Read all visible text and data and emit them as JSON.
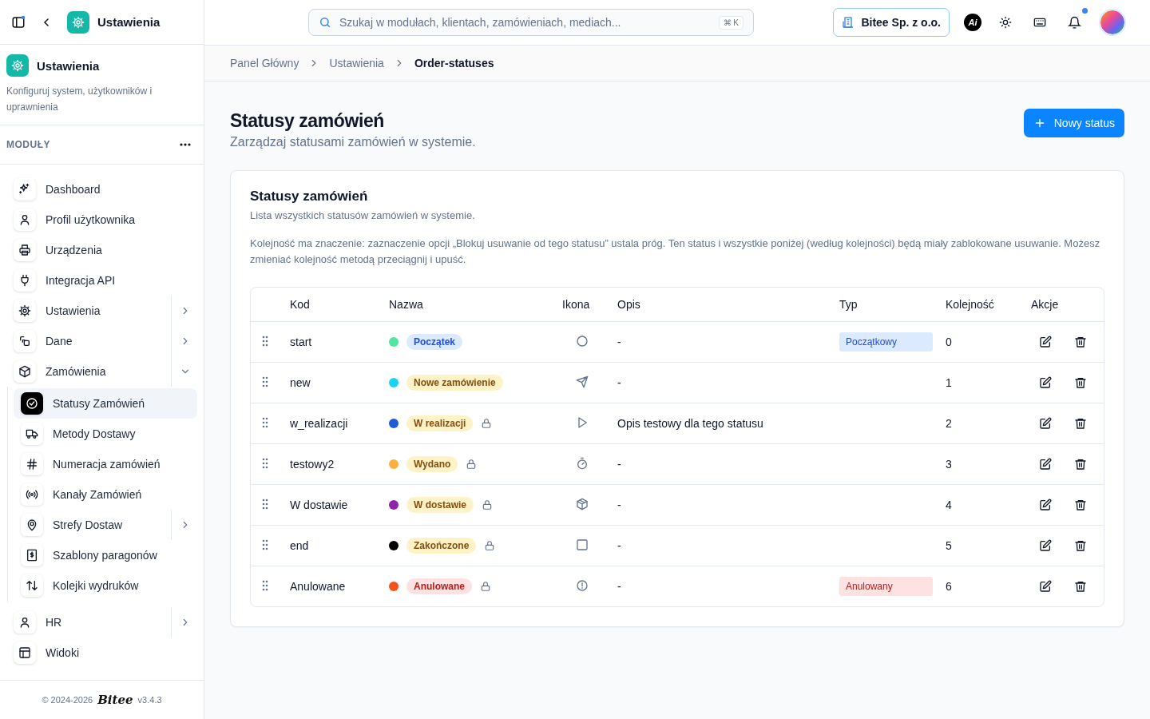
{
  "app_header": {
    "title": "Ustawienia"
  },
  "sidebar": {
    "title": "Ustawienia",
    "description": "Konfiguruj system, użytkowników i uprawnienia",
    "section": "MODUŁY",
    "items": [
      {
        "label": "Dashboard",
        "kind": "sparkles",
        "selected": false
      },
      {
        "label": "Profil użytkownika",
        "kind": "user",
        "selected": false
      },
      {
        "label": "Urządzenia",
        "kind": "printer",
        "selected": false
      },
      {
        "label": "Integracja API",
        "kind": "plug",
        "selected": false
      },
      {
        "label": "Ustawienia",
        "kind": "cog",
        "selected": false,
        "expandable": true,
        "expanded": false
      },
      {
        "label": "Dane",
        "kind": "shapes",
        "selected": false,
        "expandable": true,
        "expanded": false
      },
      {
        "label": "Zamówienia",
        "kind": "box",
        "selected": false,
        "expandable": true,
        "expanded": true,
        "children": [
          {
            "label": "Statusy Zamówień",
            "kind": "check",
            "selected": true
          },
          {
            "label": "Metody Dostawy",
            "kind": "truck",
            "selected": false
          },
          {
            "label": "Numeracja zamówień",
            "kind": "hash",
            "selected": false
          },
          {
            "label": "Kanały Zamówień",
            "kind": "radio",
            "selected": false
          },
          {
            "label": "Strefy Dostaw",
            "kind": "pin",
            "selected": false,
            "expandable": true,
            "expanded": false
          },
          {
            "label": "Szablony paragonów",
            "kind": "receipt",
            "selected": false
          },
          {
            "label": "Kolejki wydruków",
            "kind": "arrows",
            "selected": false
          }
        ]
      },
      {
        "label": "HR",
        "kind": "user",
        "selected": false,
        "expandable": true,
        "expanded": false
      },
      {
        "label": "Widoki",
        "kind": "layout",
        "selected": false
      }
    ],
    "footer": {
      "copyright": "© 2024-2026",
      "brand": "Bitee",
      "version": "v3.4.3"
    }
  },
  "topbar": {
    "search": {
      "placeholder": "Szukaj w modułach, klientach, zamówieniach, mediach...",
      "shortcut": "⌘ K"
    },
    "company": "Bitee Sp. z o.o.",
    "ai_label": "Ai",
    "notifications_unread": true
  },
  "breadcrumbs": [
    {
      "label": "Panel Główny",
      "current": false
    },
    {
      "label": "Ustawienia",
      "current": false
    },
    {
      "label": "Order-statuses",
      "current": true
    }
  ],
  "page": {
    "title": "Statusy zamówień",
    "subtitle": "Zarządzaj statusami zamówień w systemie.",
    "primary_button": "Nowy status"
  },
  "card": {
    "title": "Statusy zamówień",
    "subtitle": "Lista wszystkich statusów zamówień w systemie.",
    "note": "Kolejność ma znaczenie: zaznaczenie opcji „Blokuj usuwanie od tego statusu” ustala próg. Ten status i wszystkie poniżej (według kolejności) będą miały zablokowane usuwanie. Możesz zmieniać kolejność metodą przeciągnij i upuść."
  },
  "table": {
    "columns": [
      "Kod",
      "Nazwa",
      "Ikona",
      "Opis",
      "Typ",
      "Kolejność",
      "Akcje"
    ],
    "rows": [
      {
        "code": "start",
        "name": "Początek",
        "color": "#4ee6a0",
        "kind": "initial",
        "locked": false,
        "status_icon": {
          "kind": "circle"
        },
        "description": "-",
        "type": "Początkowy",
        "order": "0"
      },
      {
        "code": "new",
        "name": "Nowe zamówienie",
        "color": "#19d4f0",
        "kind": "normal",
        "locked": false,
        "status_icon": {
          "kind": "send"
        },
        "description": "-",
        "order": "1"
      },
      {
        "code": "w_realizacji",
        "name": "W realizacji",
        "color": "#1e5ad8",
        "kind": "normal",
        "locked": true,
        "status_icon": {
          "kind": "play"
        },
        "description": "Opis testowy dla tego statusu",
        "order": "2"
      },
      {
        "code": "testowy2",
        "name": "Wydano",
        "color": "#fbb03b",
        "kind": "normal",
        "locked": true,
        "status_icon": {
          "kind": "timer"
        },
        "description": "-",
        "order": "3"
      },
      {
        "code": "W dostawie",
        "name": "W dostawie",
        "color": "#8e24aa",
        "kind": "normal",
        "locked": true,
        "status_icon": {
          "kind": "package"
        },
        "description": "-",
        "order": "4"
      },
      {
        "code": "end",
        "name": "Zakończone",
        "color": "#000000",
        "kind": "normal",
        "locked": true,
        "status_icon": {
          "kind": "square"
        },
        "description": "-",
        "order": "5"
      },
      {
        "code": "Anulowane",
        "name": "Anulowane",
        "color": "#f4511e",
        "kind": "cancelled",
        "locked": true,
        "status_icon": {
          "kind": "alert"
        },
        "description": "-",
        "type": "Anulowany",
        "order": "6"
      }
    ]
  }
}
